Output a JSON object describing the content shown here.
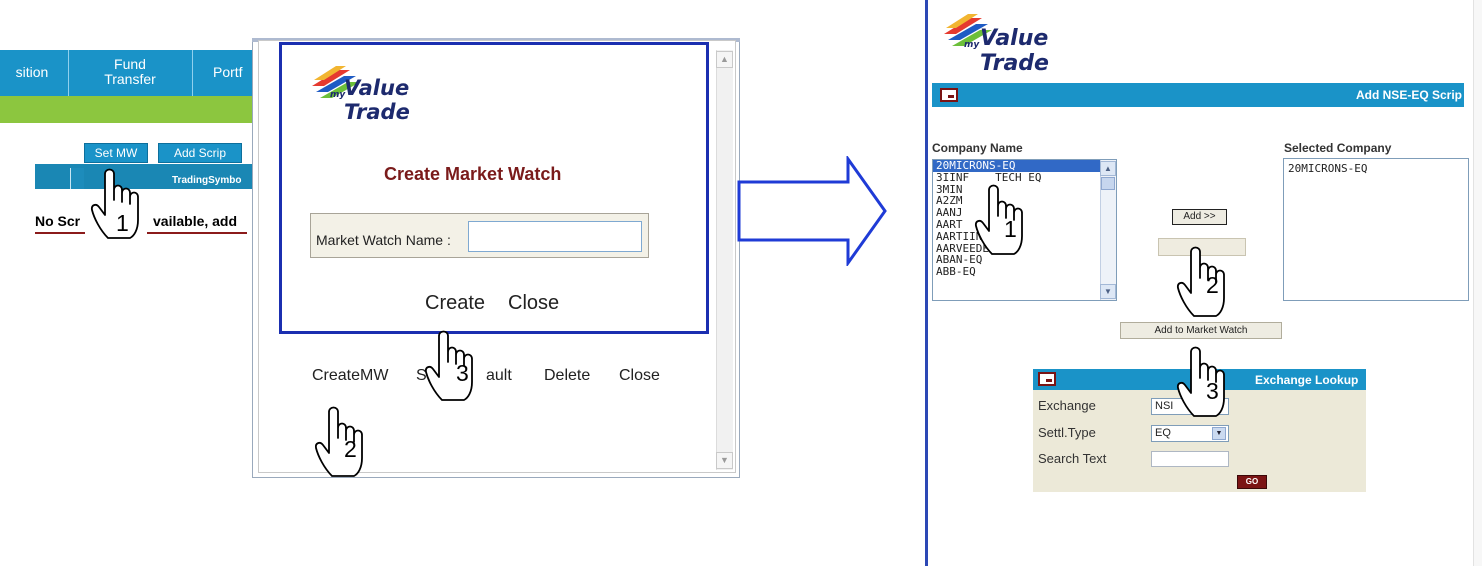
{
  "left": {
    "nav": [
      "sition",
      "Fund\nTransfer",
      "Portf"
    ],
    "buttons": {
      "set_mw": "Set MW",
      "add_scrip": "Add Scrip"
    },
    "table_header": "TradingSymbo",
    "message_start": "No Scr",
    "message_end": "vailable, add",
    "dialog": {
      "logo": "Value Trade",
      "logo_prefix": "my",
      "title": "Create Market Watch",
      "field_label": "Market Watch Name :",
      "field_value": "",
      "create": "Create",
      "close": "Close"
    },
    "bottom_links": {
      "createmw": "CreateMW",
      "s": "S",
      "default": "ault",
      "delete": "Delete",
      "close": "Close"
    }
  },
  "right": {
    "logo": "Value Trade",
    "logo_prefix": "my",
    "bar_title": "Add NSE-EQ Scrip",
    "company_label": "Company Name",
    "selected_label": "Selected Company",
    "companies": [
      "20MICRONS-EQ",
      "3IINF",
      "3MIN",
      "A2ZM",
      "AANJ",
      "AART",
      "AARTIIND-EQ",
      "AARVEEDEN-EQ",
      "ABAN-EQ",
      "ABB-EQ"
    ],
    "company_fragments": {
      "three_iinf_tail": "TECH EQ",
      "aart_tail": "Q"
    },
    "selected_companies": [
      "20MICRONS-EQ"
    ],
    "add_button": "Add >>",
    "add_to_mw_button": "Add to Market Watch",
    "lookup": {
      "title": "Exchange Lookup",
      "exchange_label": "Exchange",
      "exchange_value": "NSI",
      "settl_label": "Settl.Type",
      "settl_value": "EQ",
      "search_label": "Search Text",
      "search_value": "",
      "go": "GO"
    }
  },
  "steps": [
    "1",
    "2",
    "3",
    "1",
    "2",
    "3"
  ],
  "colors": {
    "nav_blue": "#1a93c8",
    "nav_green": "#8cc63f",
    "dialog_border": "#1b2fb0",
    "title_red": "#7a1b1b",
    "arrow_blue": "#1f3bd6"
  }
}
